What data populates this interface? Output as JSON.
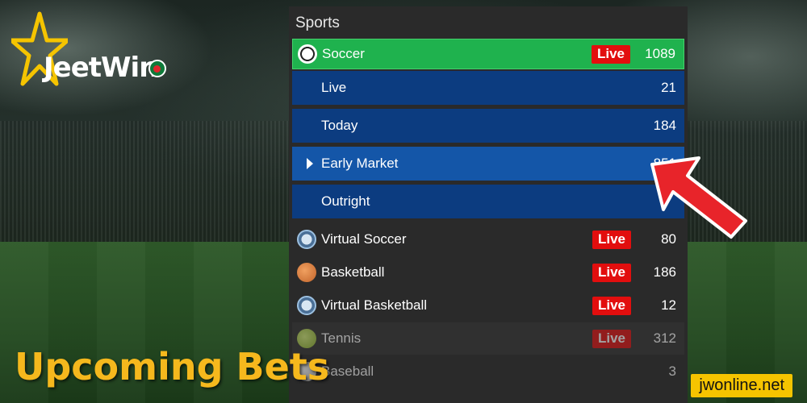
{
  "brand": {
    "name_part1": "Jeet",
    "name_part2": "Win"
  },
  "panel": {
    "title": "Sports",
    "soccer": {
      "label": "Soccer",
      "live": "Live",
      "count": "1089",
      "icon": "soccer-ball-icon"
    },
    "soccer_sub": [
      {
        "label": "Live",
        "count": "21"
      },
      {
        "label": "Today",
        "count": "184"
      },
      {
        "label": "Early Market",
        "count": "851",
        "active": true
      },
      {
        "label": "Outright",
        "count": ""
      }
    ],
    "sports": [
      {
        "label": "Virtual Soccer",
        "live": "Live",
        "count": "80",
        "icon": "virtual-soccer-icon"
      },
      {
        "label": "Basketball",
        "live": "Live",
        "count": "186",
        "icon": "basketball-icon"
      },
      {
        "label": "Virtual Basketball",
        "live": "Live",
        "count": "12",
        "icon": "virtual-basketball-icon"
      },
      {
        "label": "Tennis",
        "live": "Live",
        "count": "312",
        "icon": "tennis-ball-icon"
      },
      {
        "label": "Baseball",
        "live": "",
        "count": "3",
        "icon": "baseball-icon"
      }
    ]
  },
  "caption": "Upcoming Bets",
  "site_tag": "jwonline.net",
  "colors": {
    "accent_green": "#1fb24e",
    "live_red": "#e20e0e",
    "sub_blue": "#0c3c80",
    "caption_gold": "#f5b81d",
    "arrow_red": "#e8242a"
  }
}
